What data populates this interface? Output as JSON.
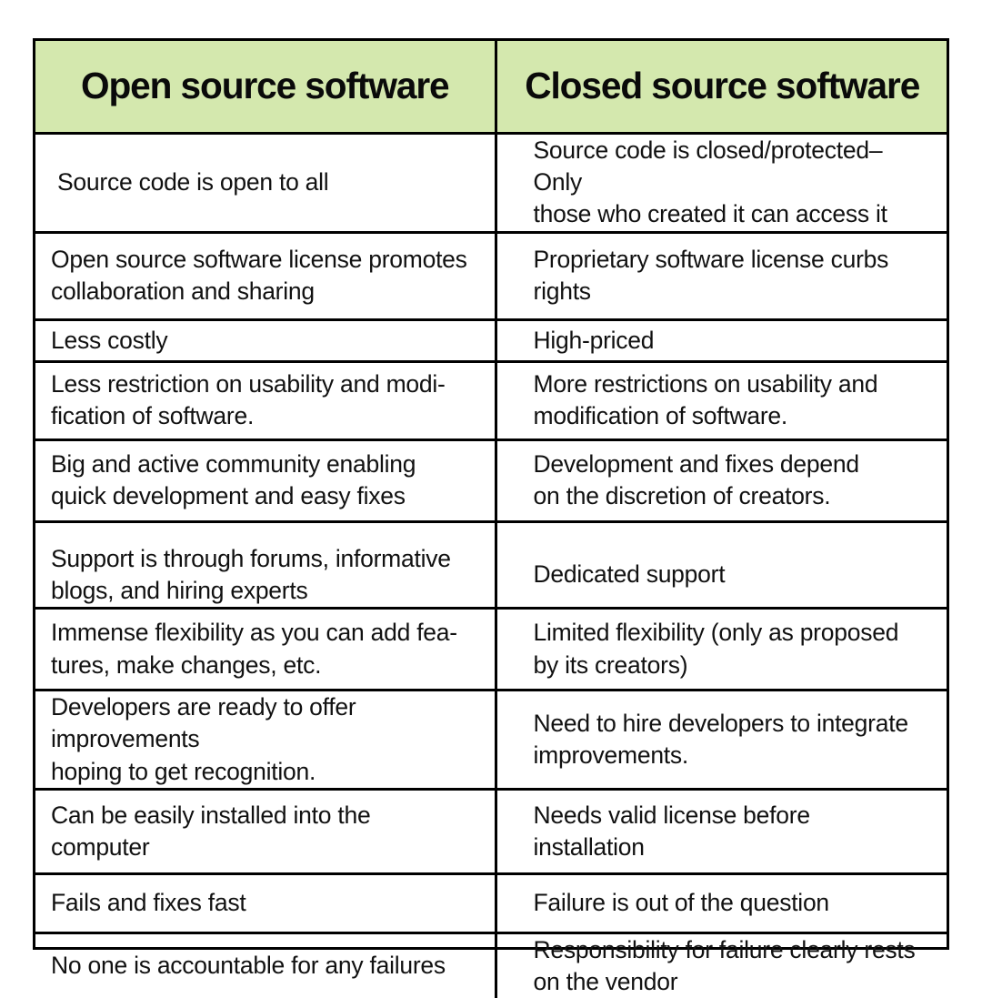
{
  "theme": {
    "header_background": "#d4e8ae",
    "border_color": "#000000",
    "text_color": "#111111",
    "page_background": "#ffffff"
  },
  "table": {
    "columns": [
      {
        "label": "Open source software"
      },
      {
        "label": "Closed source software"
      }
    ],
    "rows": [
      {
        "open": "Source code is open to all",
        "closed": "Source code is closed/protected– Only\nthose who created it can access it"
      },
      {
        "open": "Open source software license promotes\ncollaboration and sharing",
        "closed": "Proprietary software license curbs rights"
      },
      {
        "open": "Less costly",
        "closed": "High-priced"
      },
      {
        "open": "Less restriction on usability and modi-\nfication of software.",
        "closed": "More restrictions on usability and\nmodification of software."
      },
      {
        "open": "Big and active community enabling\nquick development and easy fixes",
        "closed": "Development and fixes depend\non the discretion of creators."
      },
      {
        "open": "Support is through forums, informative\nblogs, and hiring experts",
        "closed": "Dedicated support"
      },
      {
        "open": "Immense flexibility as you can add fea-\ntures, make changes, etc.",
        "closed": "Limited flexibility (only as proposed\nby its creators)"
      },
      {
        "open": "Developers are ready to offer improvements\nhoping to get recognition.",
        "closed": "Need to hire developers to integrate\nimprovements."
      },
      {
        "open": "Can be easily installed into the\ncomputer",
        "closed": "Needs valid license before\ninstallation"
      },
      {
        "open": "Fails and fixes fast",
        "closed": "Failure is out of the question"
      },
      {
        "open": "No one is accountable for any failures",
        "closed": "Responsibility for failure clearly rests\non the vendor"
      }
    ]
  }
}
